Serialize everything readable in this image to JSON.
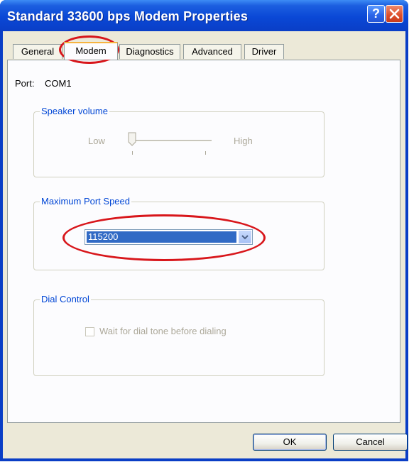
{
  "window": {
    "title": "Standard 33600 bps Modem Properties"
  },
  "titlebar_buttons": {
    "help": "?",
    "close": "X"
  },
  "tabs": [
    {
      "label": "General"
    },
    {
      "label": "Modem",
      "active": true
    },
    {
      "label": "Diagnostics"
    },
    {
      "label": "Advanced"
    },
    {
      "label": "Driver"
    }
  ],
  "port": {
    "label": "Port:",
    "value": "COM1"
  },
  "speaker_volume": {
    "legend": "Speaker volume",
    "low": "Low",
    "high": "High",
    "level": 0.0
  },
  "max_port_speed": {
    "legend": "Maximum Port Speed",
    "value": "115200"
  },
  "dial_control": {
    "legend": "Dial Control",
    "checkbox_label": "Wait for dial tone before dialing",
    "checked": false
  },
  "buttons": {
    "ok": "OK",
    "cancel": "Cancel"
  },
  "colors": {
    "highlight_ring": "#d8161b",
    "title_bar": "#0a48d6",
    "selection": "#316ac5"
  }
}
